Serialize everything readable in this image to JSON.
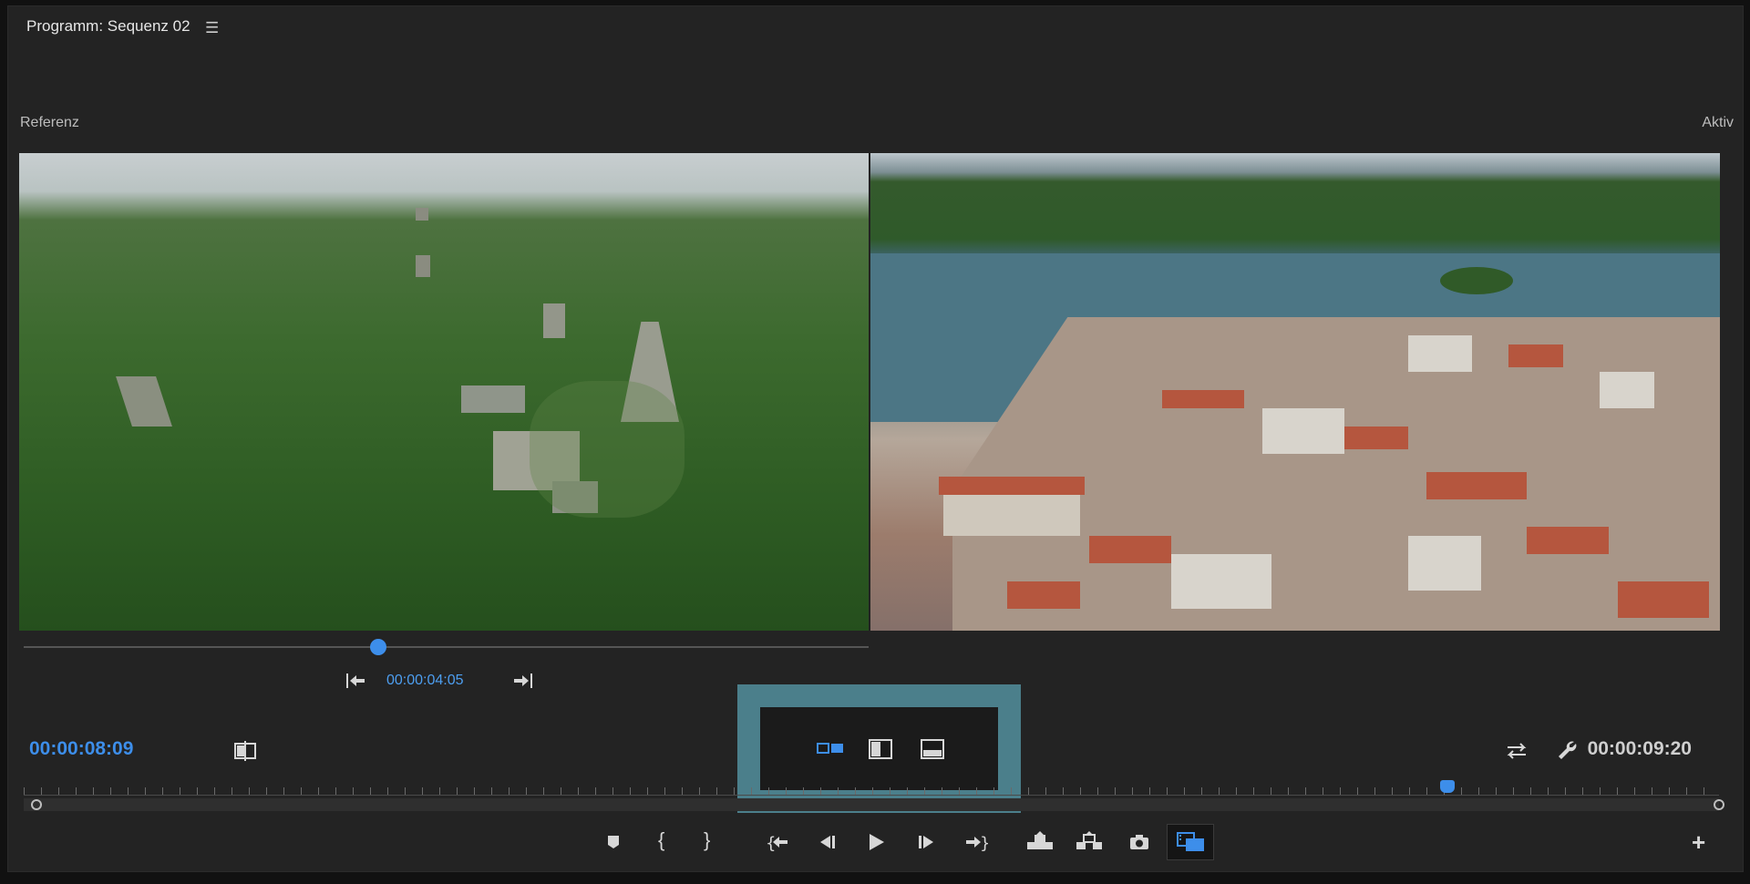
{
  "panel": {
    "title": "Programm: Sequenz 02",
    "menu_icon": "hamburger-menu-icon"
  },
  "compare": {
    "reference_label": "Referenz",
    "active_label": "Aktiv",
    "reference_timecode": "00:00:04:05",
    "reference_scrub_progress": 0.42
  },
  "transport": {
    "current_timecode": "00:00:08:09",
    "duration_timecode": "00:00:09:20",
    "playhead_progress": 0.84
  },
  "colors": {
    "accent": "#3d8eea",
    "highlight": "#4b7f8b",
    "panel_bg": "#232323"
  },
  "icons": {
    "go_to_prev": "go-to-previous-edit-icon",
    "go_to_next": "go-to-next-edit-icon",
    "side_by_side": "side-by-side-view-icon",
    "vertical_split": "vertical-split-view-icon",
    "horizontal_split": "horizontal-split-view-icon",
    "add_marker": "add-marker-icon",
    "mark_in": "mark-in-icon",
    "mark_out": "mark-out-icon",
    "go_to_in": "go-to-in-icon",
    "step_back": "step-back-icon",
    "play": "play-icon",
    "step_forward": "step-forward-icon",
    "go_to_out": "go-to-out-icon",
    "lift": "lift-icon",
    "extract": "extract-icon",
    "export_frame": "camera-icon",
    "comparison_view": "comparison-view-icon",
    "add_button": "plus-icon",
    "swap": "swap-arrows-icon",
    "settings": "wrench-icon",
    "split_toggle": "split-view-toggle-icon"
  }
}
